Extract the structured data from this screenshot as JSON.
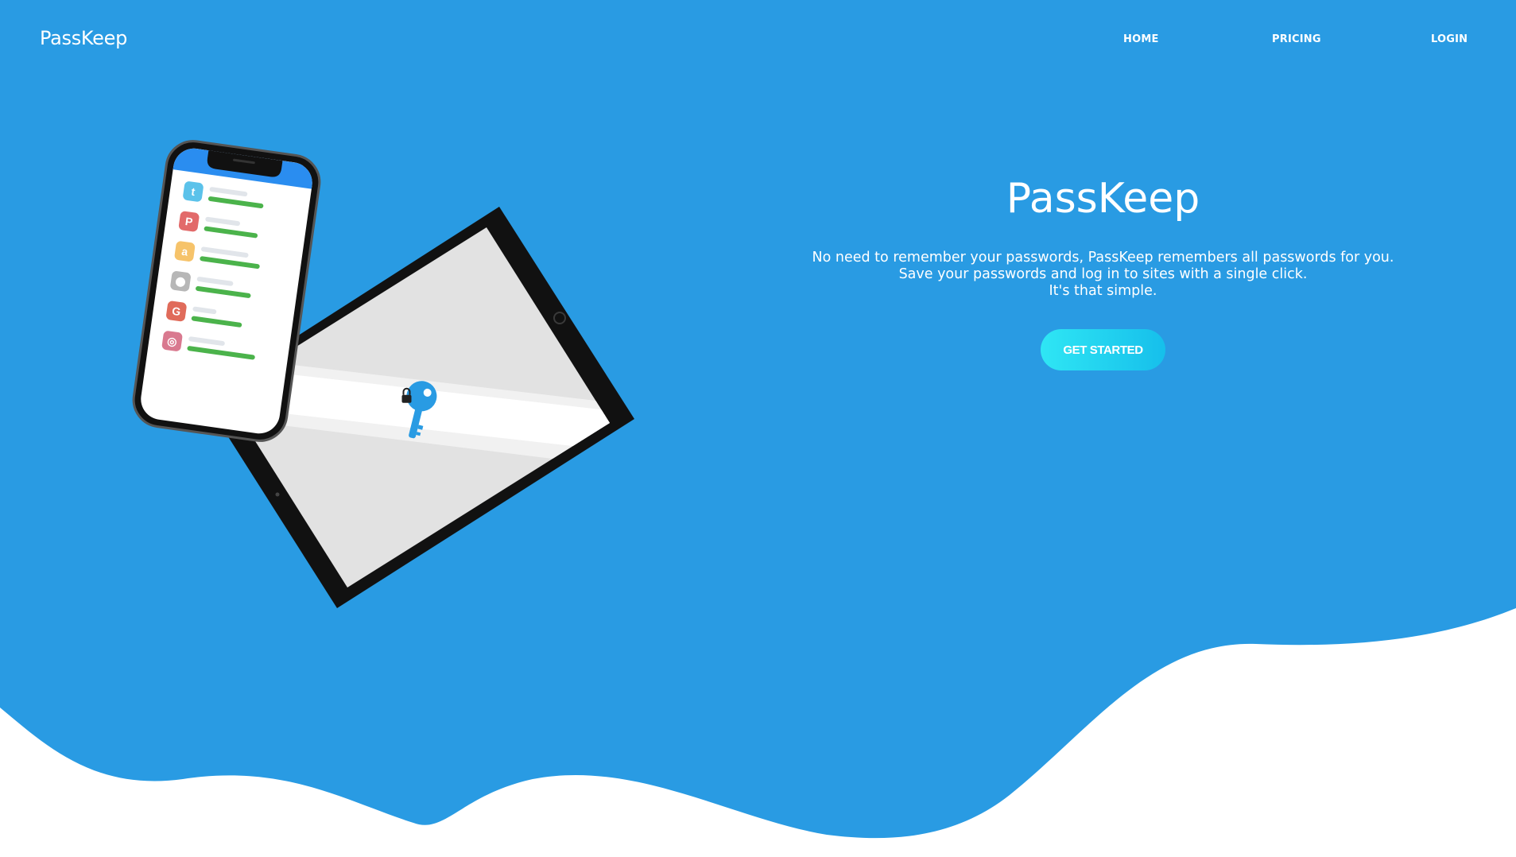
{
  "brand": {
    "name": "PassKeep"
  },
  "nav": {
    "links": [
      {
        "label": "HOME"
      },
      {
        "label": "PRICING"
      },
      {
        "label": "LOGIN"
      }
    ]
  },
  "hero": {
    "title": "PassKeep",
    "description_lines": [
      "No need to remember your passwords, PassKeep remembers all passwords for you.",
      "Save your passwords and log in to sites with a single click.",
      "It's that simple."
    ],
    "cta_label": "GET STARTED"
  },
  "illustration": {
    "phone_apps": [
      {
        "icon": "twitter-icon",
        "glyph": "t",
        "color": "#5bc2ea"
      },
      {
        "icon": "pinterest-icon",
        "glyph": "P",
        "color": "#e26a6a"
      },
      {
        "icon": "amazon-icon",
        "glyph": "a",
        "color": "#f6c36a"
      },
      {
        "icon": "apple-icon",
        "glyph": "",
        "color": "#b7b7b7"
      },
      {
        "icon": "google-icon",
        "glyph": "G",
        "color": "#e06b5a"
      },
      {
        "icon": "instagram-icon",
        "glyph": "◎",
        "color": "#d9798f"
      }
    ]
  },
  "colors": {
    "hero_blue": "#299be3",
    "wave_white": "#ffffff",
    "cta_gradient_start": "#2fe6f4",
    "cta_gradient_end": "#16bfeb",
    "progress_green": "#4bb34b",
    "key_blue": "#299be3"
  }
}
